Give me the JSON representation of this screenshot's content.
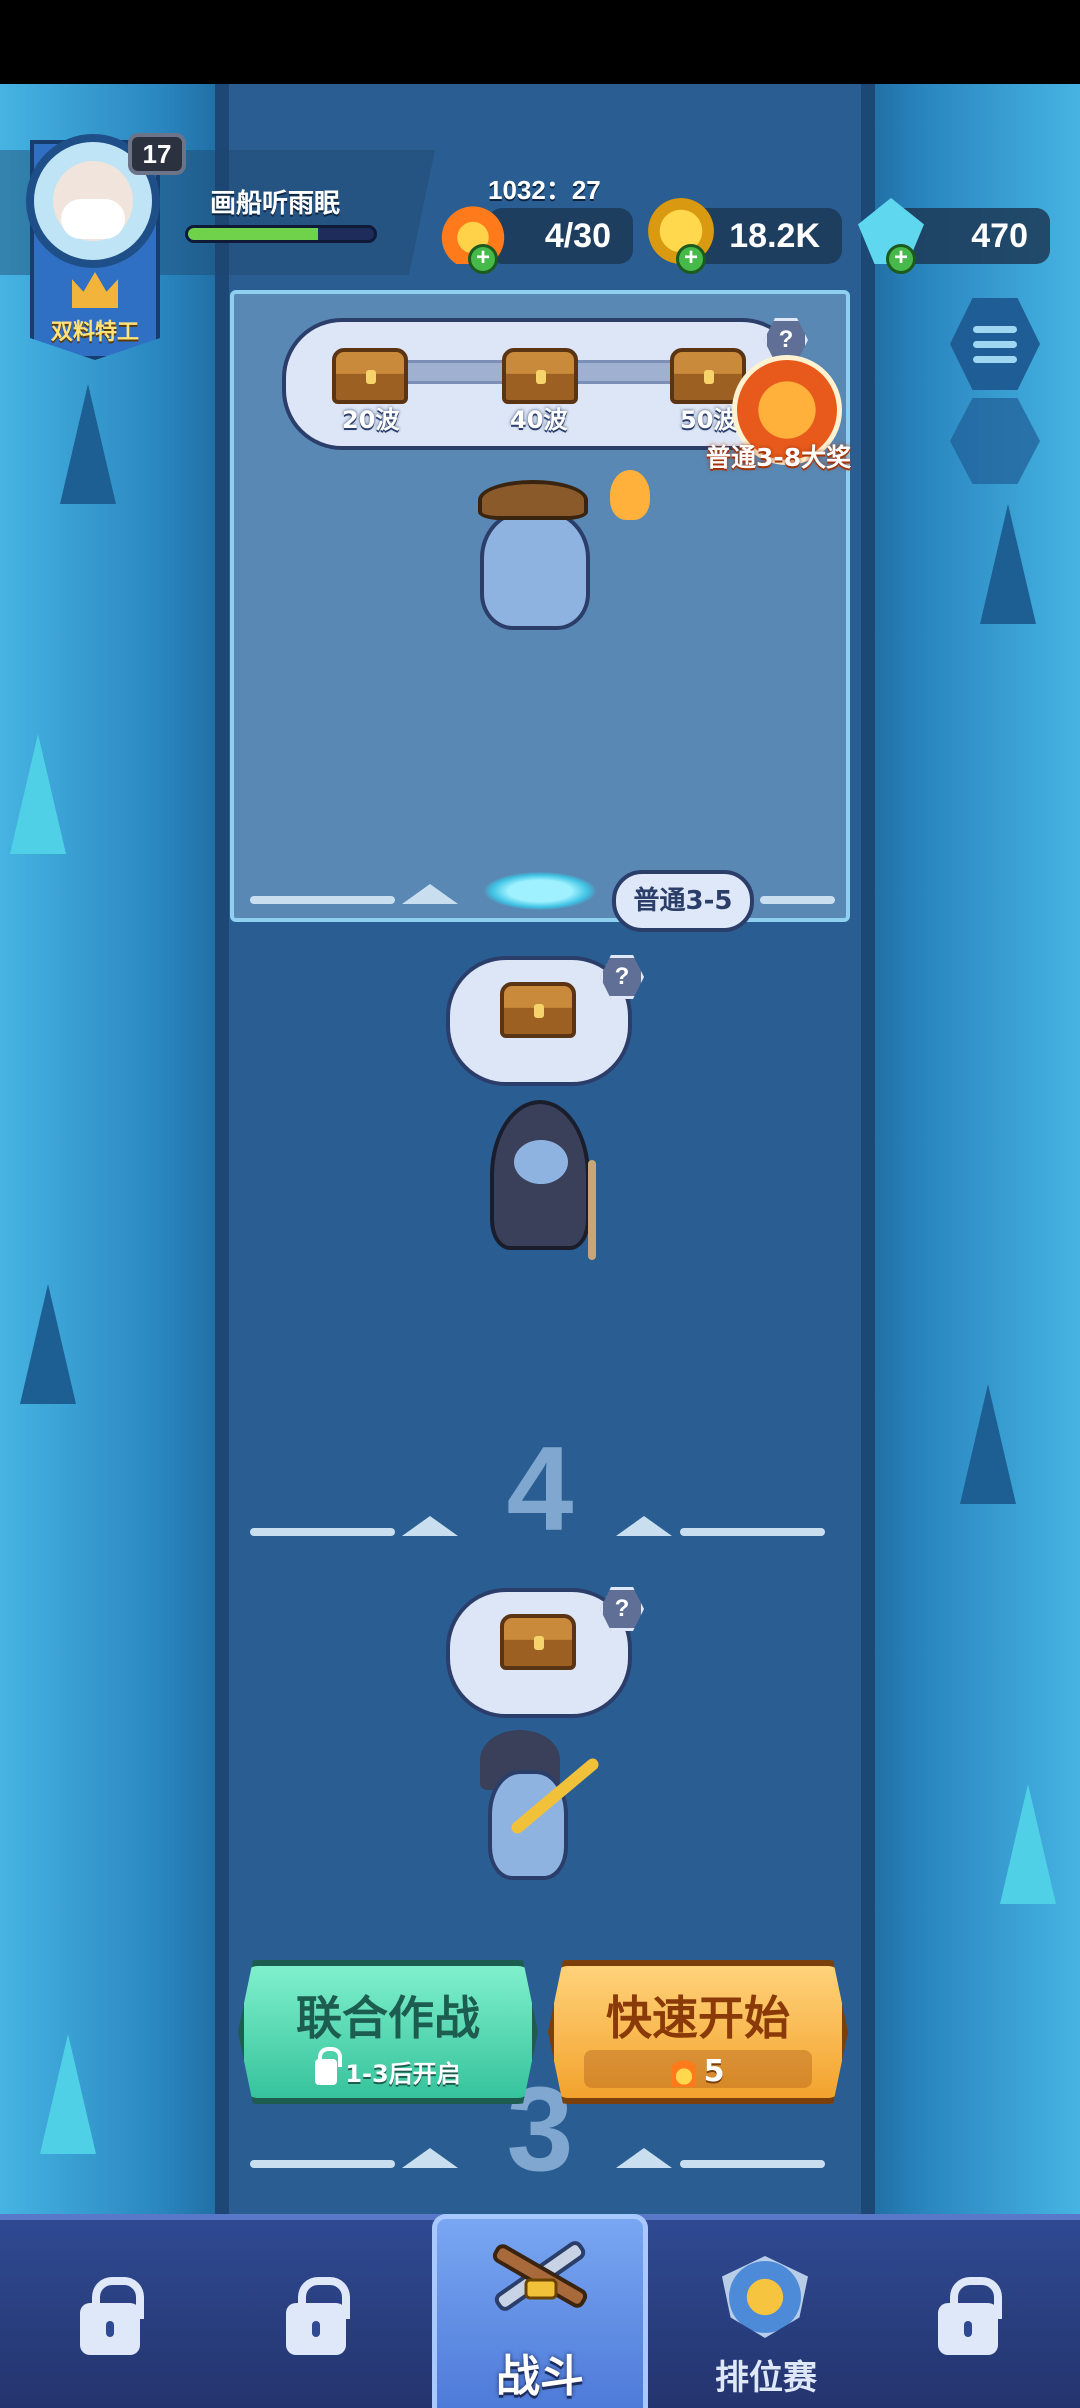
{
  "player": {
    "name": "画船听雨眠",
    "level": "17",
    "title": "双料特工",
    "xp_fraction": 0.7
  },
  "resources": {
    "timer": "1032：27",
    "energy": "4/30",
    "coins": "18.2K",
    "gems": "470"
  },
  "wave_rewards": {
    "milestones": [
      "20波",
      "40波",
      "50波"
    ],
    "grand_prize_label": "普通3-8大奖",
    "help": "?"
  },
  "stage": {
    "current_tag": "普通3-5",
    "wave_markers": [
      "4",
      "3"
    ],
    "chest_help": "?"
  },
  "actions": {
    "coop_label": "联合作战",
    "coop_sub": "1-3后开启",
    "quick_label": "快速开始",
    "quick_cost": "5"
  },
  "nav": {
    "battle_label": "战斗",
    "ranked_label": "排位赛"
  },
  "colors": {
    "river": "#2a5e93",
    "cliff": "#46b4e3",
    "coop_button": "#36c39c",
    "quick_button": "#f3a32d",
    "navbar": "#2f4a92"
  },
  "icons": [
    "energy-icon",
    "coin-icon",
    "gem-icon",
    "menu-icon",
    "chest-icon",
    "lock-icon",
    "crossed-swords-icon",
    "rank-shield-icon"
  ]
}
